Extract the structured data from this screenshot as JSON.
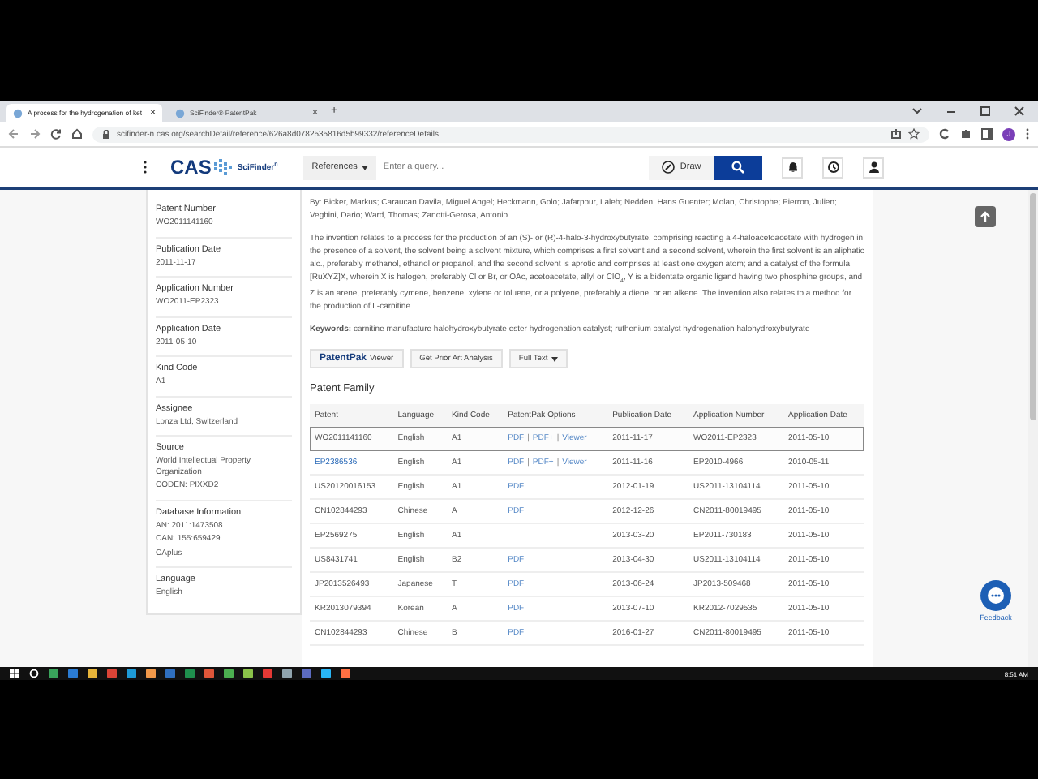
{
  "browser": {
    "tabs": [
      {
        "title": "A process for the hydrogenation of ket",
        "selected": true,
        "close": "×"
      },
      {
        "title": "SciFinder® PatentPak",
        "selected": false,
        "close": "×"
      }
    ],
    "new_tab": "+",
    "url": "scifinder-n.cas.org/searchDetail/reference/626a8d0782535816d5b99332/referenceDetails",
    "profile_initial": "J"
  },
  "header": {
    "logo": "CAS",
    "product": "SciFinder$^{n}$",
    "search_type": "References",
    "query_placeholder": "Enter a query...",
    "draw_label": "Draw"
  },
  "sidebar": {
    "fields": [
      {
        "label": "Patent Number",
        "value": "WO2011141160"
      },
      {
        "label": "Publication Date",
        "value": "2011-11-17"
      },
      {
        "label": "Application Number",
        "value": "WO2011-EP2323"
      },
      {
        "label": "Application Date",
        "value": "2011-05-10"
      },
      {
        "label": "Kind Code",
        "value": "A1"
      },
      {
        "label": "Assignee",
        "value": "Lonza Ltd, Switzerland"
      },
      {
        "label": "Source",
        "lines": [
          "World Intellectual Property Organization",
          "CODEN: PIXXD2"
        ]
      },
      {
        "label": "Database Information",
        "lines": [
          "AN: 2011:1473508",
          "CAN: 155:659429",
          "CAplus"
        ]
      },
      {
        "label": "Language",
        "value": "English"
      }
    ]
  },
  "main": {
    "authors": "By: Bicker, Markus; Caraucan Davila, Miguel Angel; Heckmann, Golo; Jafarpour, Laleh; Nedden, Hans Guenter; Molan, Christophe; Pierron, Julien; Veghini, Dario; Ward, Thomas; Zanotti-Gerosa, Antonio",
    "abstract": "The invention relates to a process for the production of an (S)- or (R)-4-halo-3-hydroxybutyrate, comprising reacting a 4-haloacetoacetate with hydrogen in the presence of a solvent, the solvent being a solvent mixture, which comprises a first solvent and a second solvent, wherein the first solvent is an aliphatic alc., preferably methanol, ethanol or propanol, and the second solvent is aprotic and comprises at least one oxygen atom; and a catalyst of the formula [RuXYZ]X, wherein X is halogen, preferably Cl or Br, or OAc, acetoacetate, allyl or ClO$_{4}$, Y is a bidentate organic ligand having two phosphine groups, and Z is an arene, preferably cymene, benzene, xylene or toluene, or a polyene, preferably a diene, or an alkene. The invention also relates to a method for the production of L-carnitine.",
    "keywords": "**Keywords:** carnitine manufacture halohydroxybutyrate ester hydrogenation catalyst; ruthenium catalyst hydrogenation halohydroxybutyrate",
    "buttons": [
      {
        "kind": "patentpak",
        "brand": "PatentPak",
        "label": "Viewer"
      },
      {
        "kind": "plain",
        "label": "Get Prior Art Analysis"
      },
      {
        "kind": "dropdown",
        "label": "Full Text"
      }
    ],
    "family_title": "Patent Family",
    "table": {
      "columns": [
        "Patent",
        "Language",
        "Kind Code",
        "PatentPak Options",
        "Publication Date",
        "Application Number",
        "Application Date"
      ],
      "rows": [
        {
          "selected": true,
          "link": false,
          "patent": "WO2011141160",
          "language": "English",
          "kind_code": "A1",
          "options": [
            "PDF",
            "|",
            "PDF+",
            "|",
            "Viewer"
          ],
          "publication_date": "2011-11-17",
          "application_number": "WO2011-EP2323",
          "application_date": "2011-05-10"
        },
        {
          "selected": false,
          "link": true,
          "patent": "EP2386536",
          "language": "English",
          "kind_code": "A1",
          "options": [
            "PDF",
            "|",
            "PDF+",
            "|",
            "Viewer"
          ],
          "publication_date": "2011-11-16",
          "application_number": "EP2010-4966",
          "application_date": "2010-05-11"
        },
        {
          "selected": false,
          "link": false,
          "patent": "US20120016153",
          "language": "English",
          "kind_code": "A1",
          "options": [
            "PDF"
          ],
          "publication_date": "2012-01-19",
          "application_number": "US2011-13104114",
          "application_date": "2011-05-10"
        },
        {
          "selected": false,
          "link": false,
          "patent": "CN102844293",
          "language": "Chinese",
          "kind_code": "A",
          "options": [
            "PDF"
          ],
          "publication_date": "2012-12-26",
          "application_number": "CN2011-80019495",
          "application_date": "2011-05-10"
        },
        {
          "selected": false,
          "link": false,
          "patent": "EP2569275",
          "language": "English",
          "kind_code": "A1",
          "options": [],
          "publication_date": "2013-03-20",
          "application_number": "EP2011-730183",
          "application_date": "2011-05-10"
        },
        {
          "selected": false,
          "link": false,
          "patent": "US8431741",
          "language": "English",
          "kind_code": "B2",
          "options": [
            "PDF"
          ],
          "publication_date": "2013-04-30",
          "application_number": "US2011-13104114",
          "application_date": "2011-05-10"
        },
        {
          "selected": false,
          "link": false,
          "patent": "JP2013526493",
          "language": "Japanese",
          "kind_code": "T",
          "options": [
            "PDF"
          ],
          "publication_date": "2013-06-24",
          "application_number": "JP2013-509468",
          "application_date": "2011-05-10"
        },
        {
          "selected": false,
          "link": false,
          "patent": "KR2013079394",
          "language": "Korean",
          "kind_code": "A",
          "options": [
            "PDF"
          ],
          "publication_date": "2013-07-10",
          "application_number": "KR2012-7029535",
          "application_date": "2011-05-10"
        },
        {
          "selected": false,
          "link": false,
          "patent": "CN102844293",
          "language": "Chinese",
          "kind_code": "B",
          "options": [
            "PDF"
          ],
          "publication_date": "2016-01-27",
          "application_number": "CN2011-80019495",
          "application_date": "2011-05-10"
        }
      ]
    }
  },
  "feedback": "Feedback",
  "taskbar": {
    "apps": [
      {
        "color": "#3aa35b"
      },
      {
        "color": "#2b7cd3"
      },
      {
        "color": "#e8b53a"
      },
      {
        "color": "#db4437"
      },
      {
        "color": "#1e9bd7"
      },
      {
        "color": "#f2994a"
      },
      {
        "color": "#2f6fbf"
      },
      {
        "color": "#1f8f4e"
      },
      {
        "color": "#e0573a"
      },
      {
        "color": "#4caf50"
      },
      {
        "color": "#8bc34a"
      },
      {
        "color": "#e53935"
      },
      {
        "color": "#90a4ae"
      },
      {
        "color": "#5c6bc0"
      },
      {
        "color": "#29b6f6"
      },
      {
        "color": "#ff7043"
      }
    ],
    "time": "8:51 AM"
  }
}
